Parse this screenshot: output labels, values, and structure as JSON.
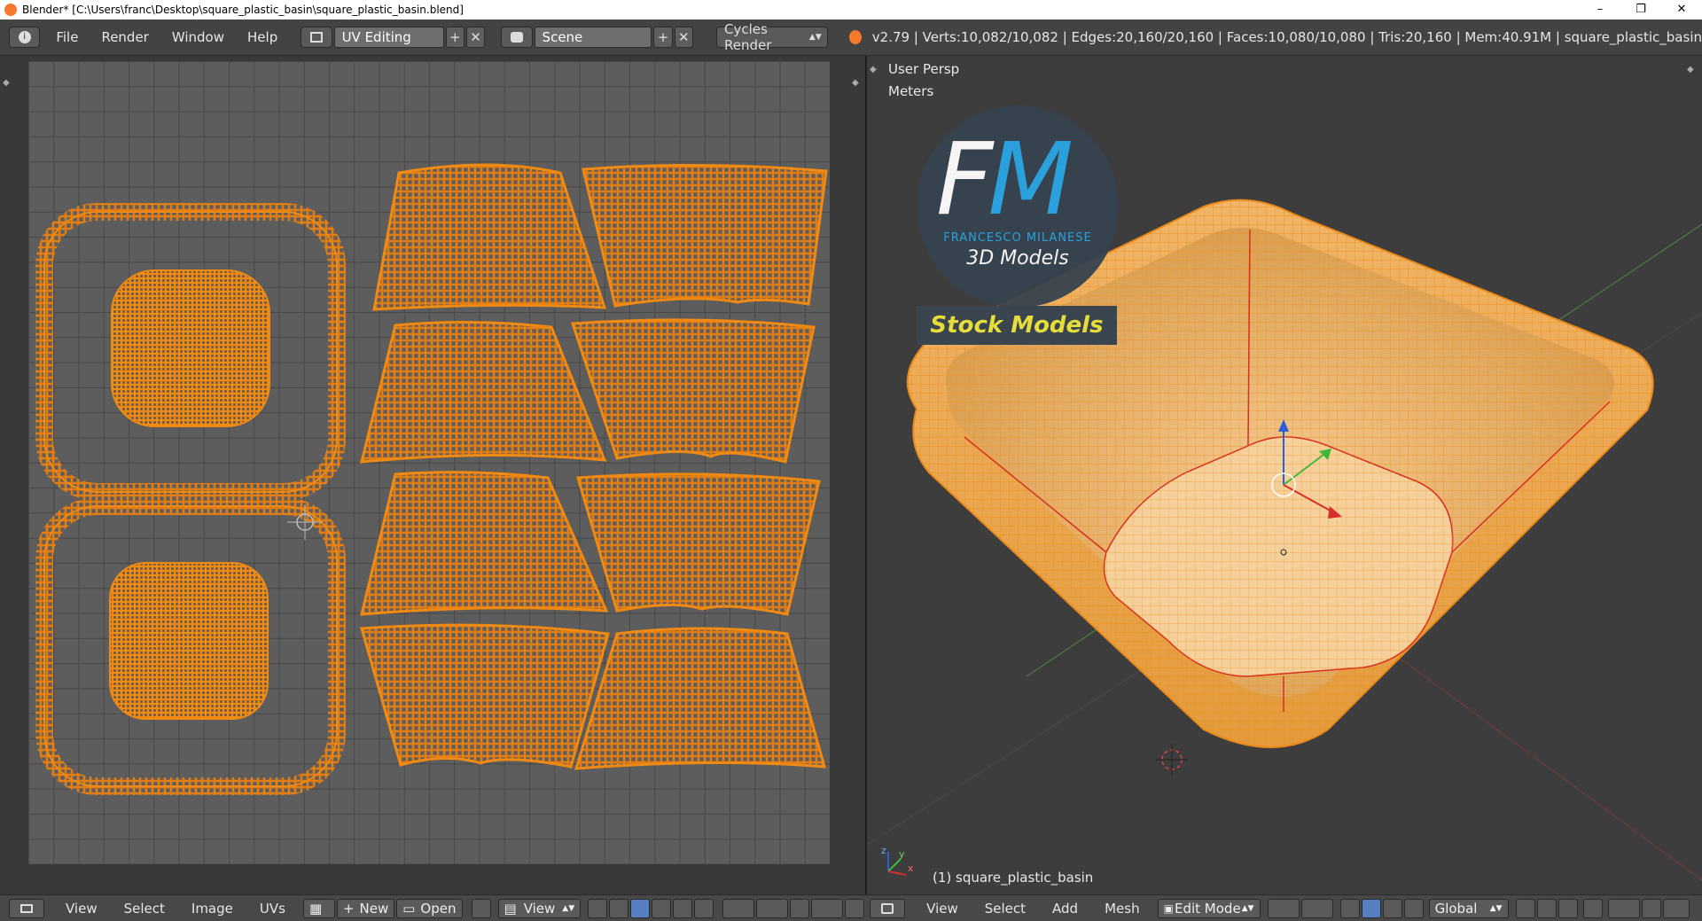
{
  "window": {
    "title": "Blender* [C:\\Users\\franc\\Desktop\\square_plastic_basin\\square_plastic_basin.blend]",
    "min": "–",
    "max": "❐",
    "close": "✕"
  },
  "infobar": {
    "menus": [
      "File",
      "Render",
      "Window",
      "Help"
    ],
    "screen_layout": "UV Editing",
    "scene": "Scene",
    "render_engine": "Cycles Render",
    "stats": "v2.79 | Verts:10,082/10,082 | Edges:20,160/20,160 | Faces:10,080/10,080 | Tris:20,160 | Mem:40.91M | square_plastic_basin"
  },
  "viewport": {
    "view_name": "User Persp",
    "units": "Meters",
    "object_label": "(1) square_plastic_basin",
    "axis_x": "x",
    "axis_y": "y",
    "axis_z": "z"
  },
  "watermark": {
    "logo": "FM",
    "brand": "FRANCESCO MILANESE",
    "line2": "3D Models",
    "badge": "Stock Models"
  },
  "uv_editor_header": {
    "menus": [
      "View",
      "Select",
      "Image",
      "UVs"
    ],
    "new_label": "New",
    "open_label": "Open",
    "view_label": "View"
  },
  "viewport_header": {
    "menus": [
      "View",
      "Select",
      "Add",
      "Mesh"
    ],
    "mode": "Edit Mode",
    "orientation": "Global"
  },
  "colors": {
    "uv_wire": "#f08a12",
    "mesh_fill": "#f0b060",
    "seam": "#d8301e",
    "ui_bg": "#393939"
  }
}
